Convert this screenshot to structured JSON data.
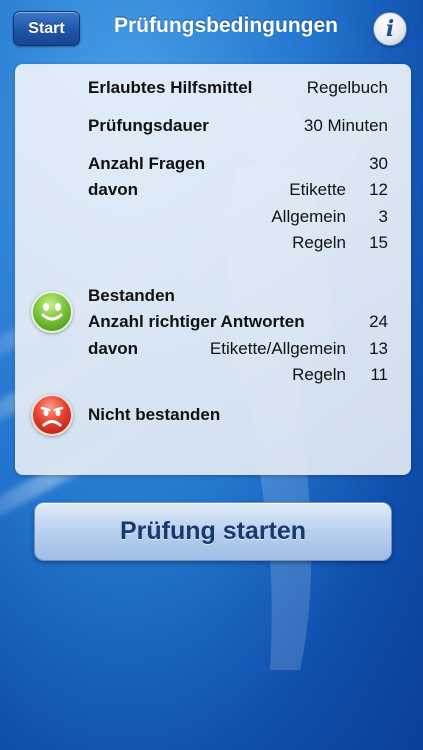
{
  "header": {
    "start_label": "Start",
    "title": "Prüfungsbedingungen",
    "info_icon": "info-icon"
  },
  "conditions": {
    "allowed_aids": {
      "label": "Erlaubtes Hilfsmittel",
      "value": "Regelbuch"
    },
    "duration": {
      "label": "Prüfungsdauer",
      "value": "30 Minuten"
    },
    "questions": {
      "label": "Anzahl Fragen",
      "value": "30",
      "breakdown_label": "davon",
      "items": [
        {
          "label": "Etikette",
          "value": "12"
        },
        {
          "label": "Allgemein",
          "value": "3"
        },
        {
          "label": "Regeln",
          "value": "15"
        }
      ]
    }
  },
  "passed": {
    "icon": "happy-smiley-icon",
    "label": "Bestanden",
    "correct_label": "Anzahl richtiger Antworten",
    "correct_value": "24",
    "breakdown_label": "davon",
    "items": [
      {
        "label": "Etikette/Allgemein",
        "value": "13"
      },
      {
        "label": "Regeln",
        "value": "11"
      }
    ]
  },
  "failed": {
    "icon": "sad-smiley-icon",
    "label": "Nicht bestanden"
  },
  "start_exam_label": "Prüfung starten",
  "colors": {
    "background": "#2476cf",
    "panel": "#e6edf6",
    "button_text": "#143a70",
    "passed": "#7cc43a",
    "failed": "#e4422e"
  }
}
